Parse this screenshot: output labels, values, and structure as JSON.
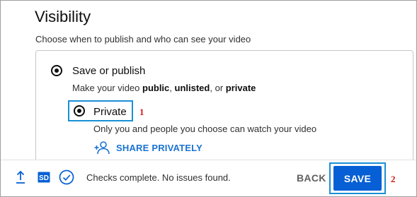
{
  "dialog": {
    "title": "Visibility",
    "subtitle": "Choose when to publish and who can see your video"
  },
  "save_or_publish": {
    "label": "Save or publish",
    "desc_prefix": "Make your video ",
    "desc_public": "public",
    "desc_sep1": ", ",
    "desc_unlisted": "unlisted",
    "desc_sep2": ", or ",
    "desc_private": "private",
    "selected": true
  },
  "private_option": {
    "label": "Private",
    "description": "Only you and people you choose can watch your video",
    "selected": true,
    "step_number": "1"
  },
  "share": {
    "label": "SHARE PRIVATELY",
    "icon": "add-person-icon"
  },
  "footer": {
    "status": "Checks complete. No issues found.",
    "back_label": "BACK",
    "save_label": "SAVE",
    "step_number": "2",
    "icons": [
      "upload-icon",
      "sd-badge-icon",
      "check-circle-icon"
    ]
  },
  "colors": {
    "accent": "#065fd4",
    "link": "#1a73d1",
    "highlight": "#1a8fd6",
    "annotation": "#d11a1a"
  }
}
